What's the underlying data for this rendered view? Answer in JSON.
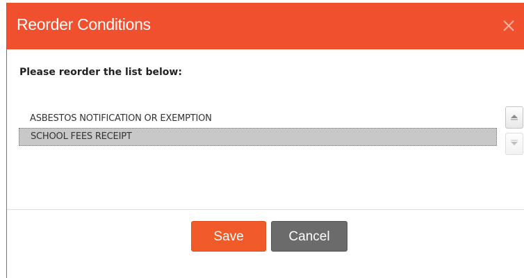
{
  "dialog": {
    "title": "Reorder Conditions",
    "instruction": "Please reorder the list below:",
    "items": [
      {
        "label": "ASBESTOS NOTIFICATION OR EXEMPTION",
        "selected": false
      },
      {
        "label": "SCHOOL FEES RECEIPT",
        "selected": true
      }
    ],
    "buttons": {
      "save": "Save",
      "cancel": "Cancel"
    },
    "icons": {
      "close": "close-icon",
      "move_up": "chevron-up-icon",
      "move_down": "chevron-down-icon"
    },
    "colors": {
      "header": "#f0502e",
      "save": "#f15a29",
      "cancel": "#6b6b6b",
      "selected_row": "#c8c8c8"
    }
  }
}
